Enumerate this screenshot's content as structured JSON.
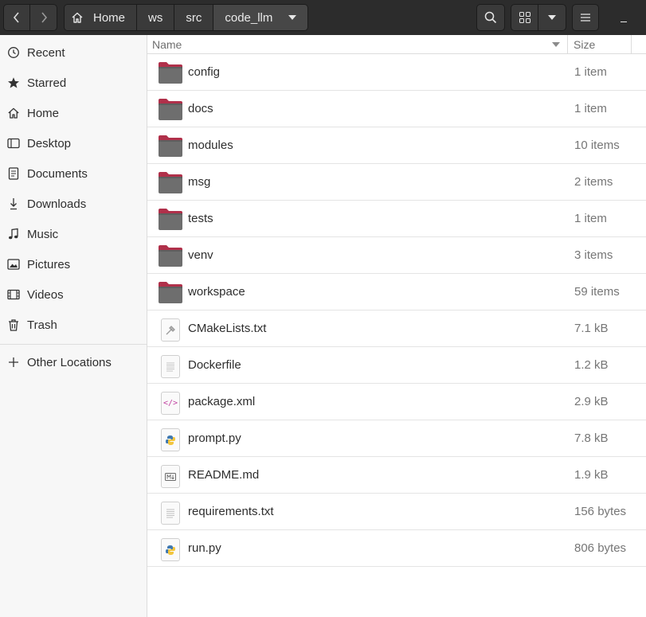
{
  "header": {
    "breadcrumbs": [
      "Home",
      "ws",
      "src",
      "code_llm"
    ],
    "icons": {
      "back": "chevron-left-icon",
      "forward": "chevron-right-icon",
      "home": "home-icon",
      "path_menu": "caret-down-icon",
      "search": "search-icon",
      "view": "grid-view-icon",
      "view_options": "caret-down-icon",
      "main_menu": "hamburger-menu-icon",
      "minimize": "minimize-icon"
    }
  },
  "sidebar": {
    "items": [
      {
        "label": "Recent",
        "icon": "clock-icon"
      },
      {
        "label": "Starred",
        "icon": "star-icon"
      },
      {
        "label": "Home",
        "icon": "home-icon"
      },
      {
        "label": "Desktop",
        "icon": "desktop-icon"
      },
      {
        "label": "Documents",
        "icon": "document-icon"
      },
      {
        "label": "Downloads",
        "icon": "download-icon"
      },
      {
        "label": "Music",
        "icon": "music-note-icon"
      },
      {
        "label": "Pictures",
        "icon": "picture-icon"
      },
      {
        "label": "Videos",
        "icon": "film-icon"
      },
      {
        "label": "Trash",
        "icon": "trash-icon"
      }
    ],
    "other_locations": {
      "label": "Other Locations",
      "icon": "plus-icon"
    }
  },
  "list": {
    "columns": {
      "name": "Name",
      "size": "Size"
    },
    "files": [
      {
        "name": "config",
        "size": "1 item",
        "type": "folder"
      },
      {
        "name": "docs",
        "size": "1 item",
        "type": "folder"
      },
      {
        "name": "modules",
        "size": "10 items",
        "type": "folder"
      },
      {
        "name": "msg",
        "size": "2 items",
        "type": "folder"
      },
      {
        "name": "tests",
        "size": "1 item",
        "type": "folder"
      },
      {
        "name": "venv",
        "size": "3 items",
        "type": "folder"
      },
      {
        "name": "workspace",
        "size": "59 items",
        "type": "folder"
      },
      {
        "name": "CMakeLists.txt",
        "size": "7.1 kB",
        "type": "cmake"
      },
      {
        "name": "Dockerfile",
        "size": "1.2 kB",
        "type": "text"
      },
      {
        "name": "package.xml",
        "size": "2.9 kB",
        "type": "xml"
      },
      {
        "name": "prompt.py",
        "size": "7.8 kB",
        "type": "python"
      },
      {
        "name": "README.md",
        "size": "1.9 kB",
        "type": "markdown"
      },
      {
        "name": "requirements.txt",
        "size": "156 bytes",
        "type": "text"
      },
      {
        "name": "run.py",
        "size": "806 bytes",
        "type": "python"
      }
    ]
  },
  "colors": {
    "headerbar": "#2c2c2c",
    "folder_body": "#6e6e6e",
    "folder_tab": "#b0304a",
    "sidebar_bg": "#f7f7f7"
  }
}
